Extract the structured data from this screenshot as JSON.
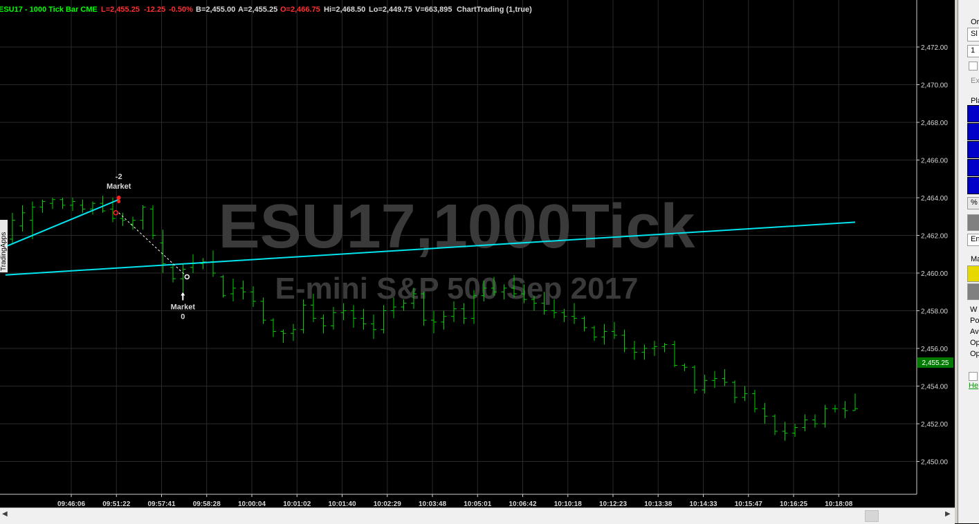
{
  "header": {
    "symbol_title": "ESU17 - 1000 Tick Bar  CME",
    "last": "L=2,455.25",
    "change": "-12.25",
    "change_pct": "-0.50%",
    "bid": "B=2,455.00",
    "ask": "A=2,455.25",
    "open": "O=2,466.75",
    "high": "Hi=2,468.50",
    "low": "Lo=2,449.75",
    "volume": "V=663,895",
    "strategy": "ChartTrading (1,true)"
  },
  "watermark": {
    "line1": "ESU17,1000Tick",
    "line2": "E-mini S&P 500 Sep 2017"
  },
  "side_label": "TradingApps",
  "colors": {
    "background": "#000000",
    "bar": "#00d200",
    "trendline": "#00e5ee",
    "last_price_box": "#007a00",
    "header_green": "#00ff00",
    "header_red": "#ff3030",
    "text": "#d8d8d8"
  },
  "orders": {
    "sell_marker": {
      "qty": "-2",
      "type": "Market"
    },
    "exit_marker": {
      "qty": "0",
      "type": "Market"
    }
  },
  "last_price_label": "2,455.25",
  "right_panel": {
    "labels": [
      "Or",
      "Sl",
      "1",
      "Ex",
      "Pla",
      "%",
      "En",
      "Ma",
      "W",
      "Po",
      "Av",
      "Op",
      "Op",
      "He"
    ]
  },
  "chart_data": {
    "type": "ohlc",
    "ylim": [
      2448.0,
      2474.0
    ],
    "y_ticks": [
      "2,472.00",
      "2,470.00",
      "2,468.00",
      "2,466.00",
      "2,464.00",
      "2,462.00",
      "2,460.00",
      "2,458.00",
      "2,456.00",
      "2,454.00",
      "2,452.00",
      "2,450.00"
    ],
    "y_tick_values": [
      2472,
      2470,
      2468,
      2466,
      2464,
      2462,
      2460,
      2458,
      2456,
      2454,
      2452,
      2450
    ],
    "x_tick_labels": [
      "09:46:06",
      "09:51:22",
      "09:57:41",
      "09:58:28",
      "10:00:04",
      "10:01:02",
      "10:01:40",
      "10:02:29",
      "10:03:48",
      "10:05:01",
      "10:06:42",
      "10:10:18",
      "10:12:23",
      "10:13:38",
      "10:14:33",
      "10:15:47",
      "10:16:25",
      "10:18:08"
    ],
    "x_tick_bars": [
      6.0,
      10.5,
      15.0,
      19.5,
      24.0,
      28.5,
      33.0,
      37.5,
      42.0,
      46.5,
      51.0,
      55.5,
      60.0,
      64.5,
      69.0,
      73.5,
      78.0,
      82.5
    ],
    "bars": [
      {
        "o": 2461.8,
        "h": 2463.2,
        "l": 2461.6,
        "c": 2462.8
      },
      {
        "o": 2462.5,
        "h": 2463.6,
        "l": 2462.2,
        "c": 2463.2
      },
      {
        "o": 2462.8,
        "h": 2463.8,
        "l": 2461.8,
        "c": 2463.5
      },
      {
        "o": 2463.5,
        "h": 2463.9,
        "l": 2463.2,
        "c": 2463.8
      },
      {
        "o": 2463.7,
        "h": 2464.0,
        "l": 2463.4,
        "c": 2463.9
      },
      {
        "o": 2463.9,
        "h": 2464.0,
        "l": 2463.4,
        "c": 2463.6
      },
      {
        "o": 2463.6,
        "h": 2464.0,
        "l": 2463.3,
        "c": 2463.8
      },
      {
        "o": 2463.6,
        "h": 2463.9,
        "l": 2463.2,
        "c": 2463.4
      },
      {
        "o": 2463.4,
        "h": 2463.8,
        "l": 2463.1,
        "c": 2463.7
      },
      {
        "o": 2463.7,
        "h": 2464.1,
        "l": 2463.2,
        "c": 2463.3
      },
      {
        "o": 2463.4,
        "h": 2464.0,
        "l": 2462.7,
        "c": 2462.9
      },
      {
        "o": 2462.9,
        "h": 2463.2,
        "l": 2462.5,
        "c": 2462.8
      },
      {
        "o": 2462.6,
        "h": 2463.0,
        "l": 2462.3,
        "c": 2462.8
      },
      {
        "o": 2462.8,
        "h": 2463.6,
        "l": 2462.3,
        "c": 2463.5
      },
      {
        "o": 2463.4,
        "h": 2463.6,
        "l": 2461.8,
        "c": 2462.0
      },
      {
        "o": 2461.6,
        "h": 2462.3,
        "l": 2460.0,
        "c": 2460.5
      },
      {
        "o": 2460.3,
        "h": 2460.5,
        "l": 2459.5,
        "c": 2459.7
      },
      {
        "o": 2459.7,
        "h": 2460.5,
        "l": 2459.0,
        "c": 2460.2
      },
      {
        "o": 2460.3,
        "h": 2461.0,
        "l": 2460.0,
        "c": 2460.5
      },
      {
        "o": 2460.5,
        "h": 2460.8,
        "l": 2460.2,
        "c": 2460.6
      },
      {
        "o": 2460.6,
        "h": 2461.2,
        "l": 2459.8,
        "c": 2460.0
      },
      {
        "o": 2459.8,
        "h": 2459.9,
        "l": 2458.7,
        "c": 2458.8
      },
      {
        "o": 2458.9,
        "h": 2459.7,
        "l": 2458.5,
        "c": 2459.2
      },
      {
        "o": 2459.2,
        "h": 2459.6,
        "l": 2458.6,
        "c": 2459.0
      },
      {
        "o": 2459.0,
        "h": 2459.3,
        "l": 2458.2,
        "c": 2458.5
      },
      {
        "o": 2458.5,
        "h": 2458.7,
        "l": 2457.3,
        "c": 2457.5
      },
      {
        "o": 2457.5,
        "h": 2457.6,
        "l": 2456.6,
        "c": 2456.9
      },
      {
        "o": 2456.9,
        "h": 2457.0,
        "l": 2456.3,
        "c": 2456.8
      },
      {
        "o": 2456.8,
        "h": 2457.3,
        "l": 2456.4,
        "c": 2457.0
      },
      {
        "o": 2457.0,
        "h": 2458.6,
        "l": 2456.8,
        "c": 2458.3
      },
      {
        "o": 2458.3,
        "h": 2458.9,
        "l": 2457.4,
        "c": 2457.6
      },
      {
        "o": 2457.6,
        "h": 2457.8,
        "l": 2456.8,
        "c": 2457.2
      },
      {
        "o": 2457.2,
        "h": 2458.2,
        "l": 2457.0,
        "c": 2457.9
      },
      {
        "o": 2457.9,
        "h": 2458.4,
        "l": 2457.5,
        "c": 2458.0
      },
      {
        "o": 2458.0,
        "h": 2458.3,
        "l": 2457.1,
        "c": 2457.6
      },
      {
        "o": 2457.6,
        "h": 2458.1,
        "l": 2457.0,
        "c": 2457.3
      },
      {
        "o": 2457.3,
        "h": 2457.8,
        "l": 2456.5,
        "c": 2457.0
      },
      {
        "o": 2457.0,
        "h": 2458.3,
        "l": 2456.8,
        "c": 2458.0
      },
      {
        "o": 2458.0,
        "h": 2458.7,
        "l": 2457.6,
        "c": 2458.2
      },
      {
        "o": 2458.2,
        "h": 2458.6,
        "l": 2458.0,
        "c": 2458.4
      },
      {
        "o": 2458.4,
        "h": 2459.2,
        "l": 2458.1,
        "c": 2458.9
      },
      {
        "o": 2458.9,
        "h": 2459.0,
        "l": 2457.2,
        "c": 2457.5
      },
      {
        "o": 2457.5,
        "h": 2458.0,
        "l": 2456.8,
        "c": 2457.4
      },
      {
        "o": 2457.4,
        "h": 2458.0,
        "l": 2457.0,
        "c": 2457.7
      },
      {
        "o": 2457.7,
        "h": 2458.5,
        "l": 2457.4,
        "c": 2458.1
      },
      {
        "o": 2458.1,
        "h": 2458.4,
        "l": 2457.3,
        "c": 2457.6
      },
      {
        "o": 2457.6,
        "h": 2459.1,
        "l": 2457.3,
        "c": 2458.8
      },
      {
        "o": 2458.8,
        "h": 2459.6,
        "l": 2458.5,
        "c": 2459.2
      },
      {
        "o": 2459.2,
        "h": 2459.8,
        "l": 2458.8,
        "c": 2459.0
      },
      {
        "o": 2459.0,
        "h": 2459.4,
        "l": 2458.6,
        "c": 2459.2
      },
      {
        "o": 2459.2,
        "h": 2459.9,
        "l": 2458.7,
        "c": 2458.9
      },
      {
        "o": 2458.9,
        "h": 2459.4,
        "l": 2458.4,
        "c": 2458.6
      },
      {
        "o": 2458.6,
        "h": 2458.8,
        "l": 2458.0,
        "c": 2458.4
      },
      {
        "o": 2458.4,
        "h": 2459.0,
        "l": 2457.8,
        "c": 2458.0
      },
      {
        "o": 2458.0,
        "h": 2458.6,
        "l": 2457.6,
        "c": 2457.9
      },
      {
        "o": 2457.9,
        "h": 2458.1,
        "l": 2457.4,
        "c": 2457.7
      },
      {
        "o": 2457.7,
        "h": 2458.4,
        "l": 2457.3,
        "c": 2457.6
      },
      {
        "o": 2457.6,
        "h": 2457.7,
        "l": 2456.9,
        "c": 2457.1
      },
      {
        "o": 2457.1,
        "h": 2457.2,
        "l": 2456.4,
        "c": 2456.6
      },
      {
        "o": 2456.6,
        "h": 2457.3,
        "l": 2456.2,
        "c": 2456.9
      },
      {
        "o": 2456.9,
        "h": 2457.4,
        "l": 2456.5,
        "c": 2456.7
      },
      {
        "o": 2456.7,
        "h": 2457.0,
        "l": 2455.8,
        "c": 2456.0
      },
      {
        "o": 2456.0,
        "h": 2456.4,
        "l": 2455.4,
        "c": 2455.8
      },
      {
        "o": 2455.8,
        "h": 2456.2,
        "l": 2455.4,
        "c": 2456.0
      },
      {
        "o": 2456.0,
        "h": 2456.4,
        "l": 2455.6,
        "c": 2456.1
      },
      {
        "o": 2456.1,
        "h": 2456.3,
        "l": 2455.8,
        "c": 2456.2
      },
      {
        "o": 2456.2,
        "h": 2456.4,
        "l": 2455.0,
        "c": 2455.1
      },
      {
        "o": 2455.1,
        "h": 2455.2,
        "l": 2454.8,
        "c": 2455.0
      },
      {
        "o": 2455.0,
        "h": 2455.1,
        "l": 2453.6,
        "c": 2453.8
      },
      {
        "o": 2453.8,
        "h": 2454.6,
        "l": 2453.6,
        "c": 2454.3
      },
      {
        "o": 2454.3,
        "h": 2454.8,
        "l": 2453.9,
        "c": 2454.4
      },
      {
        "o": 2454.4,
        "h": 2454.9,
        "l": 2454.0,
        "c": 2454.2
      },
      {
        "o": 2454.2,
        "h": 2454.3,
        "l": 2453.1,
        "c": 2453.4
      },
      {
        "o": 2453.4,
        "h": 2454.0,
        "l": 2453.2,
        "c": 2453.6
      },
      {
        "o": 2453.6,
        "h": 2453.8,
        "l": 2452.6,
        "c": 2452.8
      },
      {
        "o": 2452.8,
        "h": 2453.1,
        "l": 2452.0,
        "c": 2452.4
      },
      {
        "o": 2452.4,
        "h": 2452.5,
        "l": 2451.4,
        "c": 2451.6
      },
      {
        "o": 2451.6,
        "h": 2452.1,
        "l": 2451.1,
        "c": 2451.5
      },
      {
        "o": 2451.5,
        "h": 2452.0,
        "l": 2451.3,
        "c": 2451.8
      },
      {
        "o": 2451.8,
        "h": 2452.5,
        "l": 2451.6,
        "c": 2452.2
      },
      {
        "o": 2452.2,
        "h": 2452.5,
        "l": 2451.8,
        "c": 2452.0
      },
      {
        "o": 2452.0,
        "h": 2453.0,
        "l": 2451.8,
        "c": 2452.8
      },
      {
        "o": 2452.8,
        "h": 2453.0,
        "l": 2452.6,
        "c": 2452.8
      },
      {
        "o": 2452.8,
        "h": 2453.2,
        "l": 2452.3,
        "c": 2452.7
      },
      {
        "o": 2452.7,
        "h": 2453.6,
        "l": 2452.7,
        "c": 2452.8
      }
    ],
    "trendlines": [
      {
        "from_bar": -0.7,
        "from_price": 2461.4,
        "to_bar": 10.6,
        "to_price": 2463.9
      },
      {
        "from_bar": -0.7,
        "from_price": 2459.9,
        "to_bar": 84.0,
        "to_price": 2462.7
      }
    ],
    "trade_path": {
      "from_bar": 10.6,
      "from_price": 2463.2,
      "to_bar": 17.4,
      "to_price": 2459.8
    },
    "order_markers": [
      {
        "bar": 10.6,
        "price": 2464.0
      },
      {
        "bar": 10.6,
        "price": 2463.8
      },
      {
        "bar": 10.3,
        "price": 2463.2
      },
      {
        "bar": 17.4,
        "price": 2459.8
      }
    ],
    "last_price": 2455.25
  }
}
